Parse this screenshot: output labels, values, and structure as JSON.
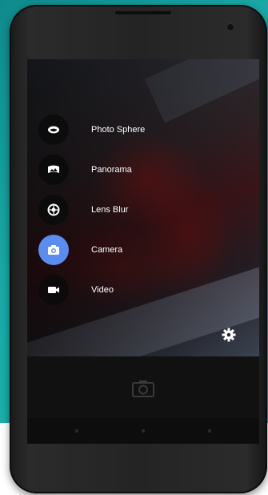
{
  "camera_app": {
    "modes": [
      {
        "label": "Photo Sphere",
        "icon": "photo-sphere-icon",
        "active": false
      },
      {
        "label": "Panorama",
        "icon": "panorama-icon",
        "active": false
      },
      {
        "label": "Lens Blur",
        "icon": "lens-blur-icon",
        "active": false
      },
      {
        "label": "Camera",
        "icon": "camera-icon",
        "active": true
      },
      {
        "label": "Video",
        "icon": "video-icon",
        "active": false
      }
    ],
    "settings_icon": "gear-icon",
    "shutter_icon": "camera-shutter-icon"
  },
  "colors": {
    "accent": "#5b8cf0",
    "background": "#1fb8b2"
  }
}
